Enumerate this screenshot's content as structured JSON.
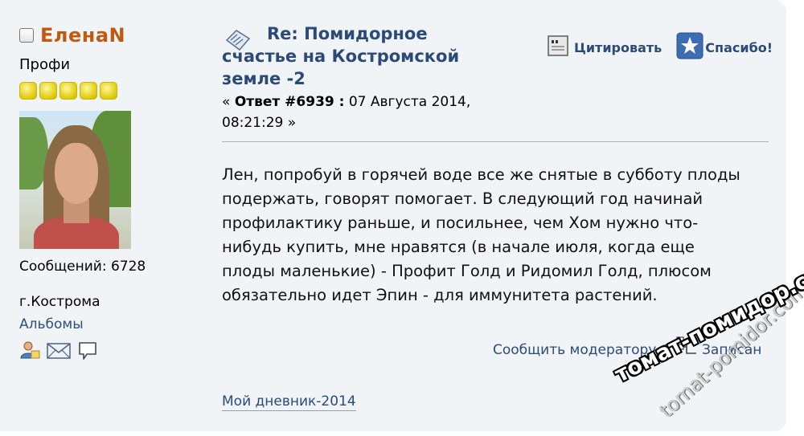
{
  "poster": {
    "username": "ЕленаN",
    "rank": "Профи",
    "stars": 5,
    "posts_label": "Сообщений: 6728",
    "location": "г.Кострома",
    "albums_link": "Альбомы"
  },
  "post": {
    "subject": "Re: Помидорное счастье на Костромской земле -2",
    "reply_prefix": "«",
    "reply_label": "Ответ #6939 :",
    "reply_date": "07 Августа 2014, 08:21:29 »",
    "text": "Лен, попробуй в горячей воде все же снятые в субботу плоды подержать, говорят помогает.     В следующий год начинай профилактику раньше, и посильнее, чем Хом нужно что-нибудь купить, мне нравятся (в начале июля, когда еще плоды маленькие) - Профит Голд и Ридомил Голд, плюсом обязательно идет Эпин - для иммунитета растений.",
    "report_link": "Сообщить модератору",
    "logged_label": "Записан",
    "signature_link": "Мой дневник-2014"
  },
  "actions": {
    "quote_label": "Цитировать",
    "thanks_label": "Спасибо!"
  },
  "watermark": {
    "main": "томат-помидор.com",
    "secondary": "tomat-pomidor.com"
  },
  "colors": {
    "username": "#c05a10",
    "link": "#2b4a78",
    "post_bg": "#f0f4f7"
  }
}
